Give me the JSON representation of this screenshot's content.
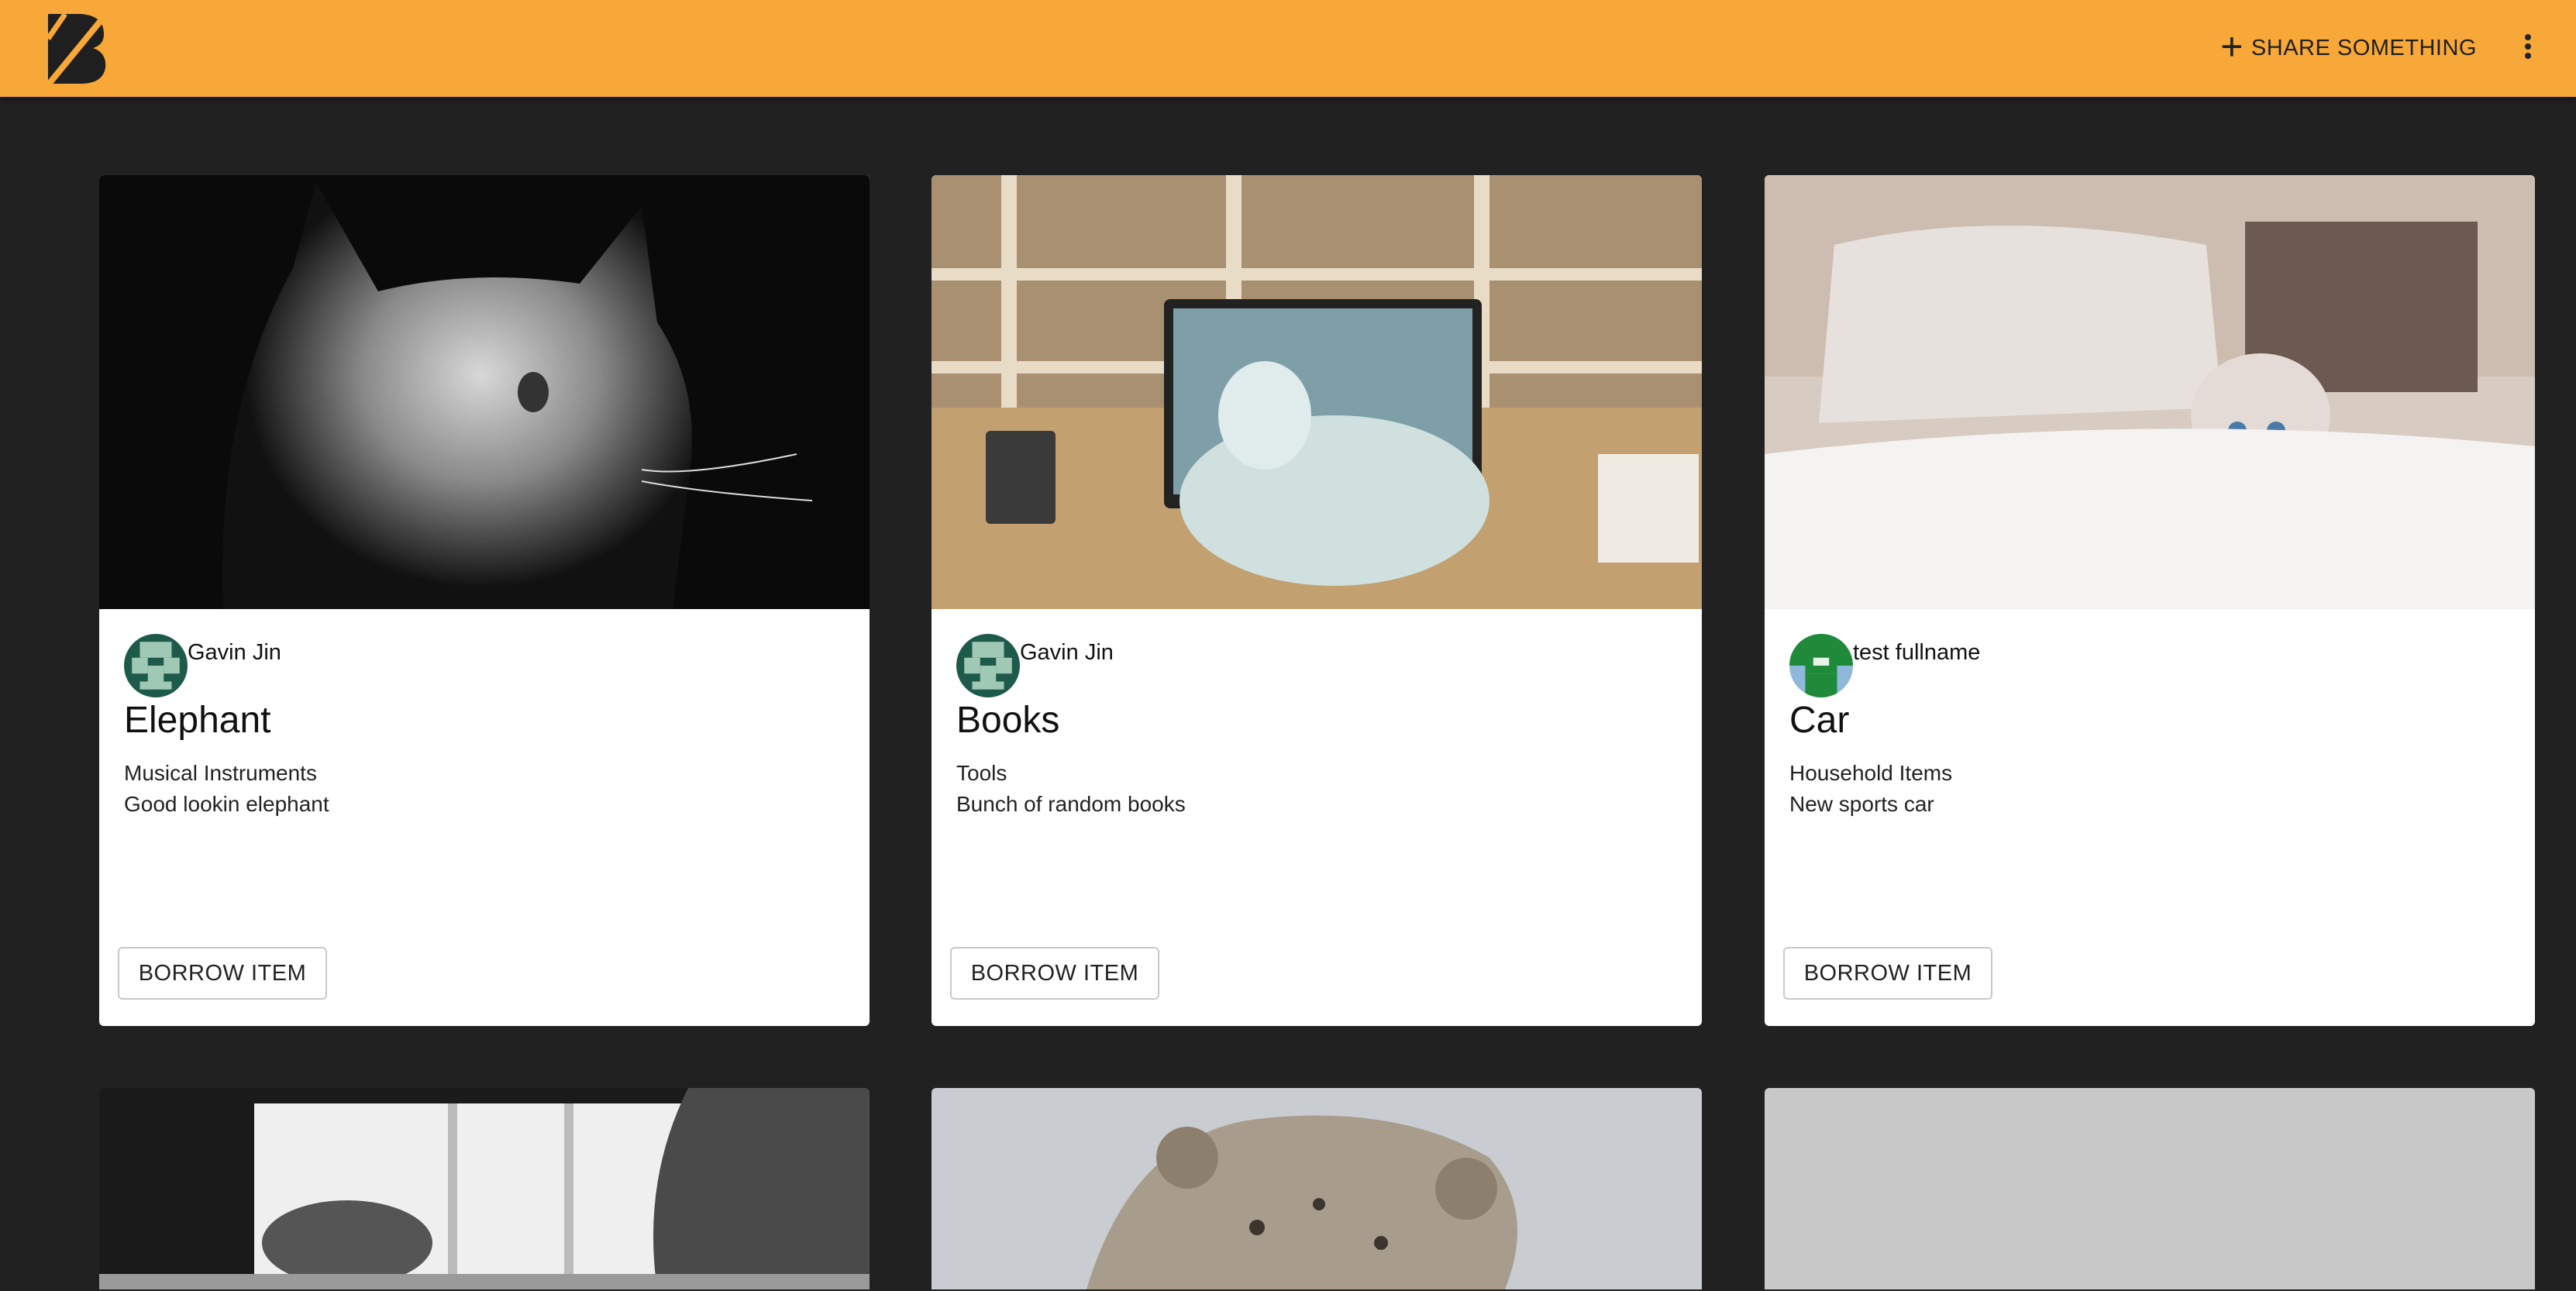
{
  "header": {
    "share_label": "SHARE SOMETHING",
    "accent_color": "#f7a838",
    "logo_icon": "boomtown-logo-icon",
    "more_icon": "more-vert-icon"
  },
  "actions": {
    "borrow_label": "BORROW ITEM"
  },
  "items": [
    {
      "owner": "Gavin Jin",
      "title": "Elephant",
      "category": "Musical Instruments",
      "description": "Good lookin elephant"
    },
    {
      "owner": "Gavin Jin",
      "title": "Books",
      "category": "Tools",
      "description": "Bunch of random books"
    },
    {
      "owner": "test fullname",
      "title": "Car",
      "category": "Household Items",
      "description": "New sports car"
    }
  ]
}
